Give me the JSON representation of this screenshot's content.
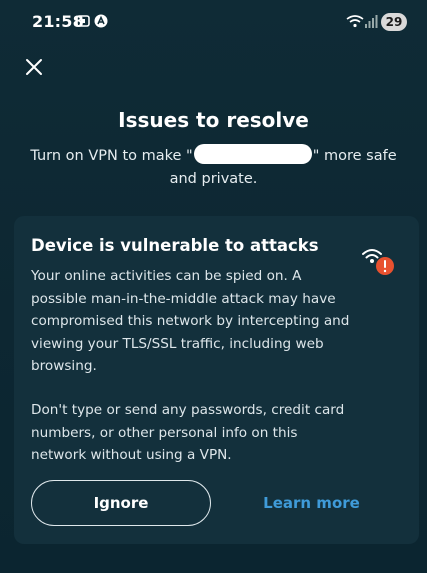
{
  "status_bar": {
    "time": "21:58",
    "battery": "29",
    "icons": [
      "screenshot-icon",
      "app-notification-icon",
      "wifi-icon",
      "signal-icon",
      "battery-icon"
    ]
  },
  "header": {
    "close_icon": "close-icon",
    "title": "Issues to resolve",
    "subtitle_prefix": "Turn on VPN to make \"",
    "subtitle_suffix": "\" more safe and private."
  },
  "card": {
    "title": "Device is vulnerable to attacks",
    "icon": "wifi-warning-icon",
    "paragraph1": "Your online activities can be spied on. A possible man-in-the-middle attack may have compromised this network by intercepting and viewing your TLS/SSL traffic, including web browsing.",
    "paragraph2": "Don't type or send any passwords, credit card numbers, or other personal info on this network without using a VPN.",
    "ignore_label": "Ignore",
    "learn_more_label": "Learn more"
  },
  "colors": {
    "background": "#0d2732",
    "card": "#13303c",
    "accent_link": "#3f9bd9",
    "warning": "#e8512f"
  }
}
